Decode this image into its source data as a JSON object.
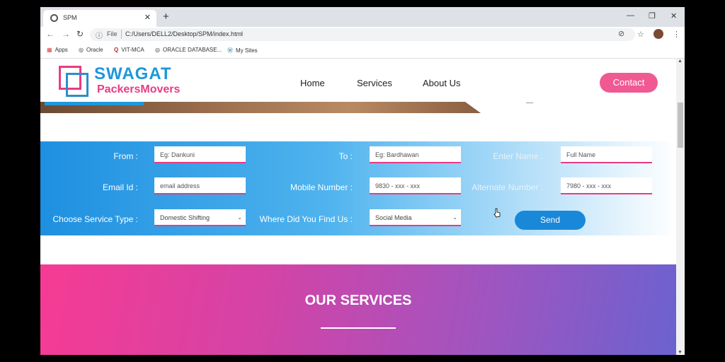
{
  "browser": {
    "tab_title": "SPM",
    "address": {
      "scheme_label": "File",
      "url": "C:/Users/DELL2/Desktop/SPM/index.html"
    },
    "bookmarks": [
      {
        "label": "Apps",
        "icon": "apps-grid-icon"
      },
      {
        "label": "Oracle",
        "icon": "globe-icon"
      },
      {
        "label": "VIT-MCA",
        "icon": "quora-icon"
      },
      {
        "label": "ORACLE DATABASE...",
        "icon": "globe-icon"
      },
      {
        "label": "My Sites",
        "icon": "wordpress-icon"
      }
    ]
  },
  "site": {
    "logo": {
      "line1": "SWAGAT",
      "line2": "PackersMovers"
    },
    "nav": [
      "Home",
      "Services",
      "About Us"
    ],
    "contact_label": "Contact"
  },
  "form": {
    "from": {
      "label": "From :",
      "placeholder": "Eg: Dankuni"
    },
    "to": {
      "label": "To :",
      "placeholder": "Eg: Bardhawan"
    },
    "name": {
      "label": "Enter Name :",
      "placeholder": "Full Name"
    },
    "email": {
      "label": "Email Id :",
      "placeholder": "email address"
    },
    "mobile": {
      "label": "Mobile Number :",
      "placeholder": "9830 - xxx - xxx"
    },
    "alt": {
      "label": "Alternate Number :",
      "placeholder": "7980 - xxx - xxx"
    },
    "service": {
      "label": "Choose Service Type :",
      "value": "Domestic Shifting"
    },
    "source": {
      "label": "Where Did You Find Us :",
      "value": "Social Media"
    },
    "send_label": "Send"
  },
  "services": {
    "heading": "OUR SERVICES"
  },
  "colors": {
    "pink": "#e73c84",
    "blue": "#1e97db",
    "contact": "#f05a93"
  }
}
